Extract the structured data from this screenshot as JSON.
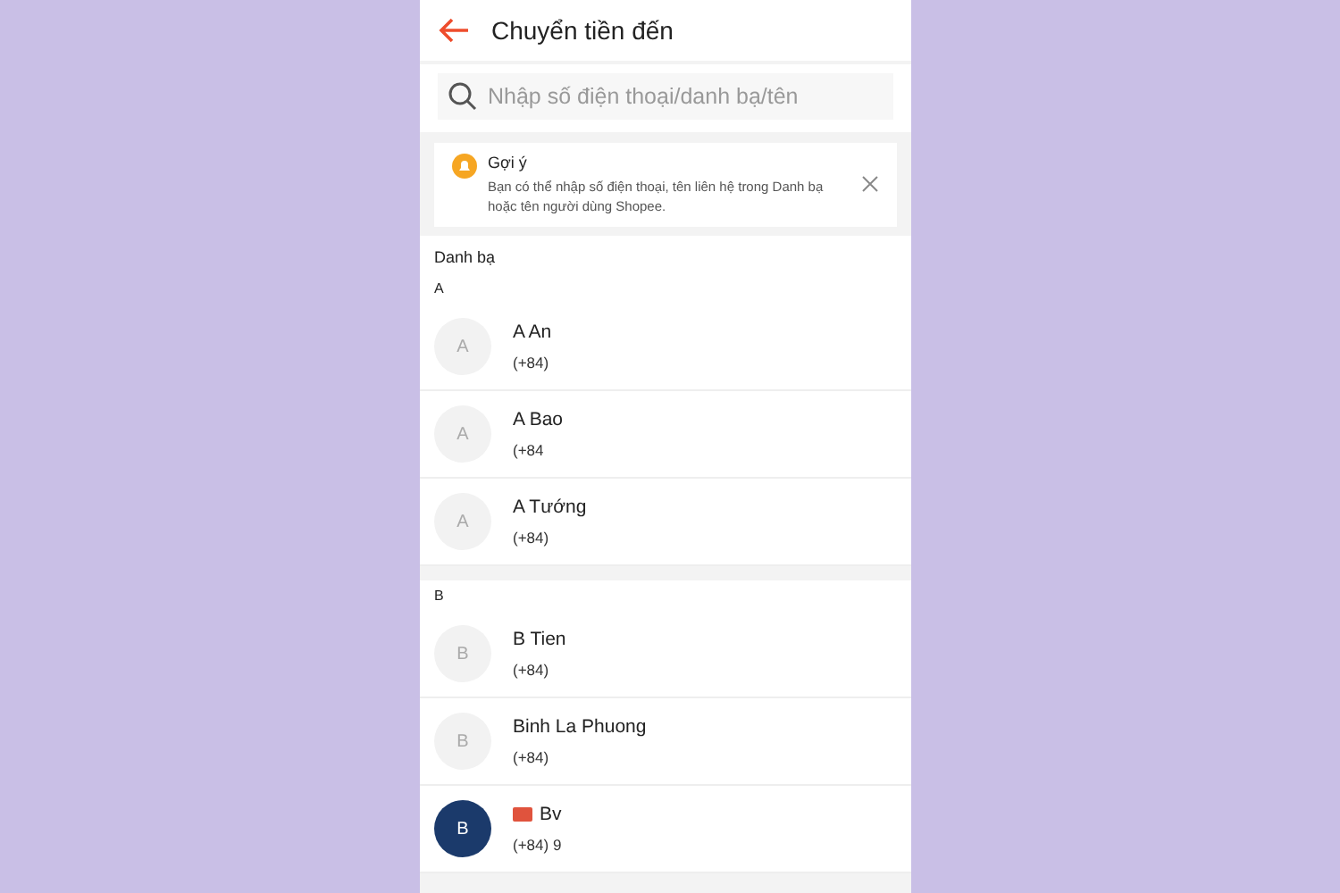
{
  "header": {
    "title": "Chuyển tiền đến"
  },
  "search": {
    "placeholder": "Nhập số điện thoại/danh bạ/tên"
  },
  "tip": {
    "title": "Gợi ý",
    "text": "Bạn có thể nhập số điện thoại, tên liên hệ trong Danh bạ hoặc tên người dùng Shopee."
  },
  "contacts_heading": "Danh bạ",
  "groups": [
    {
      "letter": "A",
      "contacts": [
        {
          "initial": "A",
          "name": "A An",
          "phone": "(+84)",
          "color": "#f2f2f2",
          "shop": false
        },
        {
          "initial": "A",
          "name": "A Bao",
          "phone": "(+84",
          "color": "#f2f2f2",
          "shop": false
        },
        {
          "initial": "A",
          "name": "A Tướng",
          "phone": "(+84)",
          "color": "#f2f2f2",
          "shop": false
        }
      ]
    },
    {
      "letter": "B",
      "contacts": [
        {
          "initial": "B",
          "name": "B Tien",
          "phone": "(+84)",
          "color": "#f2f2f2",
          "shop": false
        },
        {
          "initial": "B",
          "name": "Binh La Phuong",
          "phone": "(+84)",
          "color": "#f2f2f2",
          "shop": false
        },
        {
          "initial": "B",
          "name": "Bv",
          "phone": "(+84) 9",
          "color": "#1b3a6b",
          "shop": true
        }
      ]
    }
  ]
}
